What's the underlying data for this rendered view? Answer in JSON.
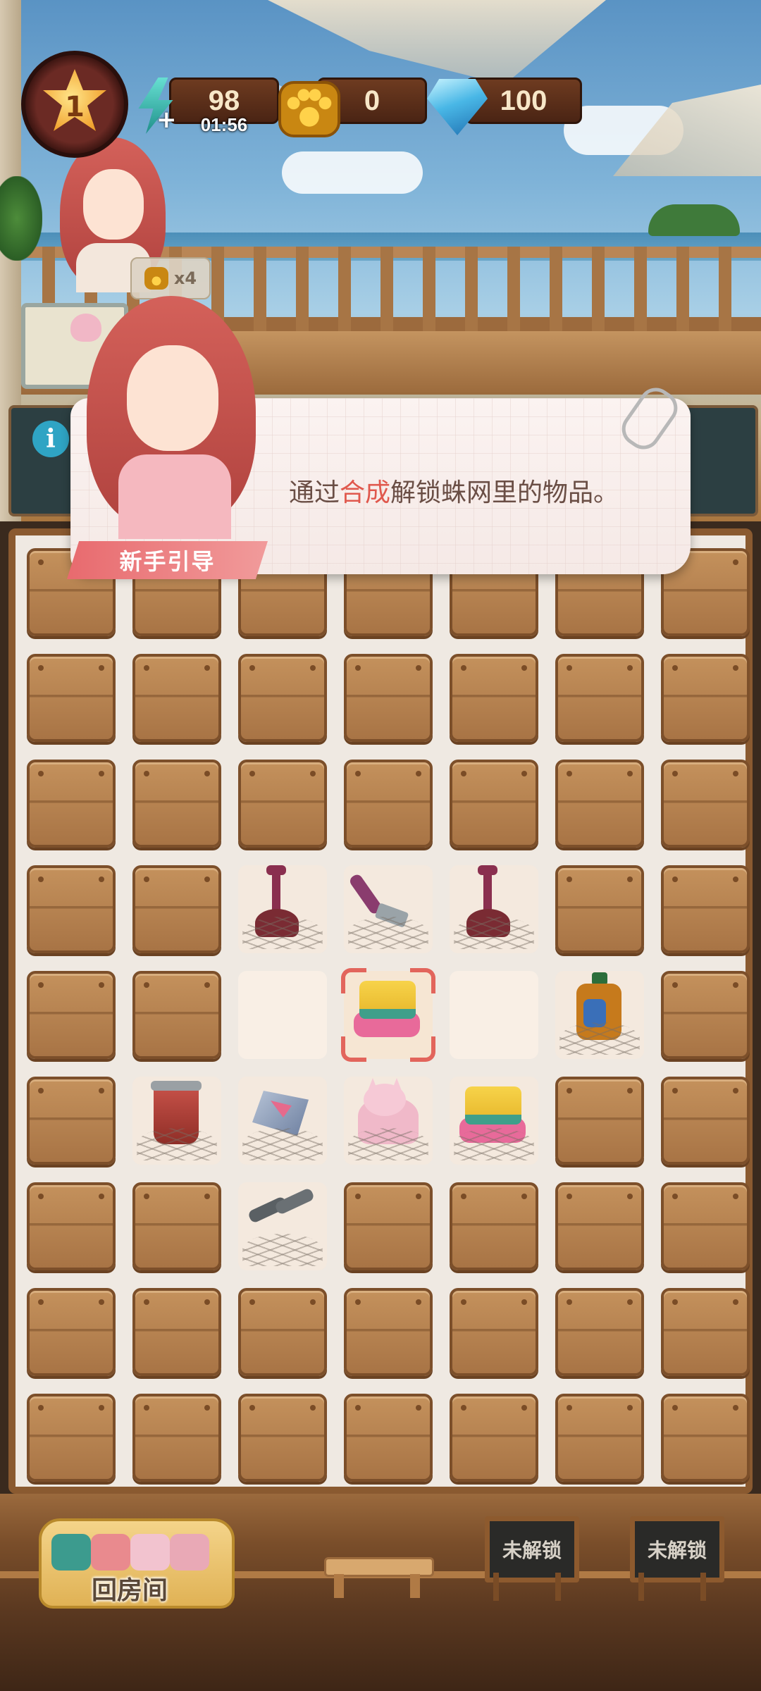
{
  "hud": {
    "level": "1",
    "energy": {
      "value": "98",
      "timer": "01:56"
    },
    "paws": {
      "value": "0"
    },
    "gems": {
      "value": "100"
    },
    "paw_multiplier": "x4"
  },
  "tutorial": {
    "label": "新手引导",
    "text_before": "通过",
    "text_highlight": "合成",
    "text_after": "解锁蛛网里的物品。"
  },
  "board": {
    "cols": 7,
    "rows": 9,
    "cells": [
      [
        "wood",
        "wood",
        "wood",
        "wood",
        "wood",
        "wood",
        "wood"
      ],
      [
        "wood",
        "wood",
        "wood",
        "wood",
        "wood",
        "wood",
        "wood"
      ],
      [
        "wood",
        "wood",
        "wood",
        "wood",
        "wood",
        "wood",
        "wood"
      ],
      [
        "wood",
        "wood",
        "web:plunger",
        "web:hammer",
        "web:plunger",
        "wood",
        "wood"
      ],
      [
        "wood",
        "wood",
        "open",
        "focus:sponge",
        "open",
        "web:detergent",
        "wood"
      ],
      [
        "wood",
        "web:trash-can",
        "web:glass-shard",
        "web:cat-cushion",
        "web:sponge",
        "wood",
        "wood"
      ],
      [
        "wood",
        "wood",
        "web:pipes",
        "wood",
        "wood",
        "wood",
        "wood"
      ],
      [
        "wood",
        "wood",
        "wood",
        "wood",
        "wood",
        "wood",
        "wood"
      ],
      [
        "wood",
        "wood",
        "wood",
        "wood",
        "wood",
        "wood",
        "wood"
      ]
    ]
  },
  "bottom": {
    "back_room_label": "回房间",
    "locked_1": "未解锁",
    "locked_2": "未解锁"
  },
  "colors": {
    "highlight_text": "#e0584d",
    "guide_label_bg": "#e86a6e",
    "wood": "#b07a45"
  }
}
